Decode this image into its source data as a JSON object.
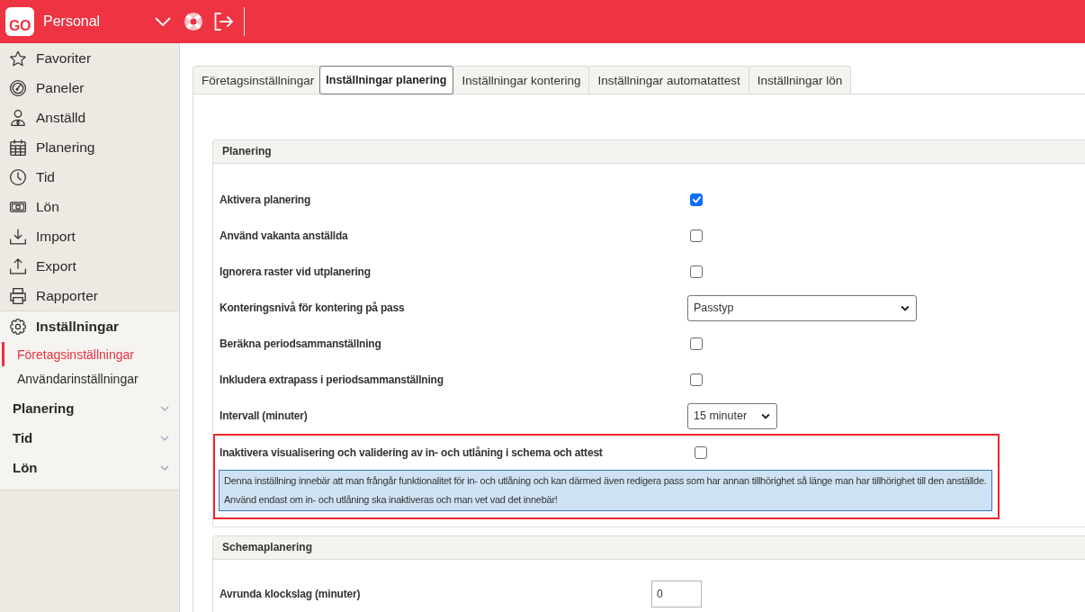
{
  "header": {
    "logo": "GO",
    "title": "Personal"
  },
  "sidebar": {
    "nav": [
      {
        "label": "Favoriter",
        "selected": false
      },
      {
        "label": "Paneler",
        "selected": false
      },
      {
        "label": "Anställd",
        "selected": false
      },
      {
        "label": "Planering",
        "selected": false
      },
      {
        "label": "Tid",
        "selected": false
      },
      {
        "label": "Lön",
        "selected": false
      },
      {
        "label": "Import",
        "selected": false
      },
      {
        "label": "Export",
        "selected": false
      },
      {
        "label": "Rapporter",
        "selected": false
      }
    ],
    "settings": {
      "label": "Inställningar",
      "selected": true,
      "links": [
        {
          "label": "Företagsinställningar",
          "selected": true
        },
        {
          "label": "Användarinställningar",
          "selected": false
        }
      ],
      "sections": [
        {
          "label": "Planering",
          "expanded": false
        },
        {
          "label": "Tid",
          "expanded": false
        },
        {
          "label": "Lön",
          "expanded": false
        }
      ]
    }
  },
  "tabs": [
    {
      "label": "Företagsinställningar",
      "selected": false
    },
    {
      "label": "Inställningar planering",
      "selected": true
    },
    {
      "label": "Inställningar kontering",
      "selected": false
    },
    {
      "label": "Inställningar automatattest",
      "selected": false
    },
    {
      "label": "Inställningar lön",
      "selected": false
    }
  ],
  "panels": [
    {
      "title": "Planering",
      "rows": [
        {
          "label": "Aktivera planering",
          "kind": "checkbox",
          "checked": true,
          "highlighted": false
        },
        {
          "label": "Använd vakanta anställda",
          "kind": "checkbox",
          "checked": false,
          "highlighted": false
        },
        {
          "label": "Ignorera raster vid utplanering",
          "kind": "checkbox",
          "checked": false,
          "highlighted": false
        },
        {
          "label": "Konteringsnivå för kontering på pass",
          "kind": "select",
          "value": "Passtyp",
          "highlighted": false
        },
        {
          "label": "Beräkna periodsammanställning",
          "kind": "checkbox",
          "checked": false,
          "highlighted": false
        },
        {
          "label": "Inkludera extrapass i periodsammanställning",
          "kind": "checkbox",
          "checked": false,
          "highlighted": false
        },
        {
          "label": "Intervall (minuter)",
          "kind": "duration",
          "value": "15 minuter",
          "highlighted": false
        },
        {
          "label": "Inaktivera visualisering och validering av in- och utlåning i schema och attest",
          "kind": "checkbox",
          "checked": false,
          "highlighted": true,
          "note": [
            "Denna inställning innebär att man frångår funktionalitet för in- och utlåning och kan därmed även redigera pass som har annan tillhörighet så länge man har tillhörighet till den anställde.",
            "Använd endast om in- och utlåning ska inaktiveras och man vet vad det innebär!"
          ]
        }
      ]
    },
    {
      "title": "Schemaplanering",
      "rows": [
        {
          "label": "Avrunda klockslag (minuter)",
          "kind": "number",
          "value": "0",
          "highlighted": false
        }
      ]
    }
  ]
}
